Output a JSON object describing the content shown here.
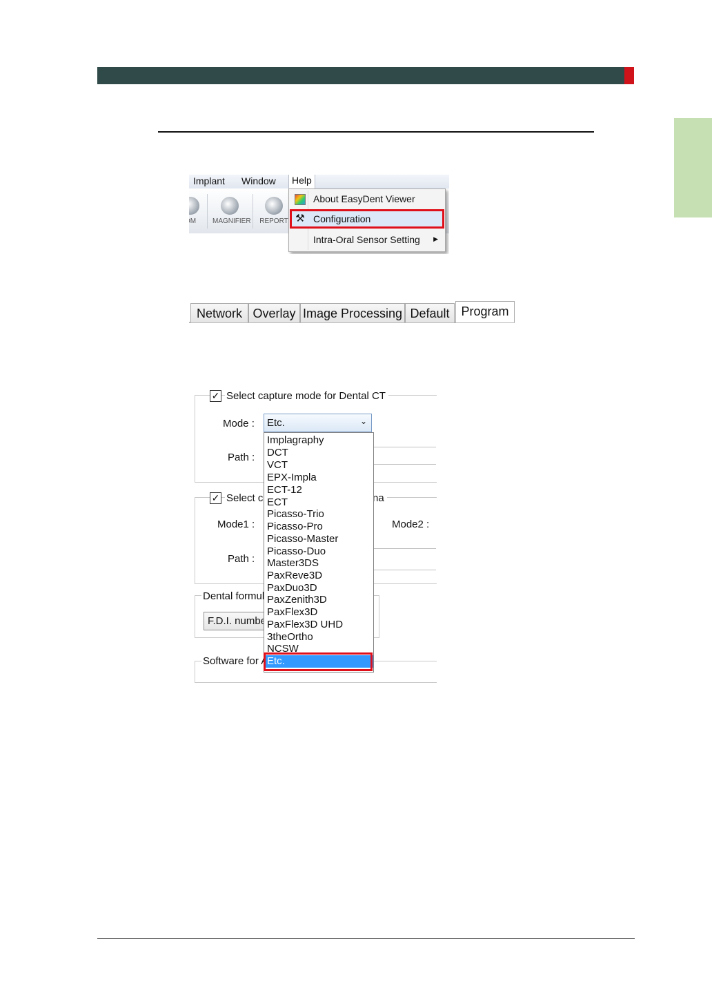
{
  "menu_bar": {
    "implant": "Implant",
    "window": "Window",
    "help": "Help"
  },
  "toolbar": {
    "zoom": "OM",
    "magnifier": "MAGNIFIER",
    "report": "REPORT"
  },
  "help_menu": [
    {
      "label": "About EasyDent Viewer",
      "icon": "color-palette-icon"
    },
    {
      "label": "Configuration",
      "icon": "tools-icon"
    },
    {
      "label": "Intra-Oral Sensor Setting",
      "icon": "",
      "submenu": true
    }
  ],
  "config_tabs": [
    {
      "label": "Network"
    },
    {
      "label": "Overlay"
    },
    {
      "label": "Image Processing"
    },
    {
      "label": "Default"
    },
    {
      "label": "Program",
      "active": true
    }
  ],
  "program_panel": {
    "ct_group_title": "Select capture mode for Dental CT",
    "ct_checked": "✓",
    "mode_label": "Mode :",
    "mode_value": "Etc.",
    "path_label": "Path :",
    "pano_group_title_start": "Select c",
    "pano_group_title_end": "na",
    "pano_checked": "✓",
    "mode1_label": "Mode1 :",
    "mode2_label": "Mode2 :",
    "path2_label": "Path :",
    "dental_formula_title": "Dental formula",
    "dental_formula_value": "F.D.I. numbe",
    "software_title": "Software for A",
    "mode_options": [
      "Implagraphy",
      "DCT",
      "VCT",
      "EPX-Impla",
      "ECT-12",
      "ECT",
      "Picasso-Trio",
      "Picasso-Pro",
      "Picasso-Master",
      "Picasso-Duo",
      "Master3DS",
      "PaxReve3D",
      "PaxDuo3D",
      "PaxZenith3D",
      "PaxFlex3D",
      "PaxFlex3D UHD",
      "3theOrtho",
      "NCSW"
    ],
    "selected_option": "Etc."
  },
  "colors": {
    "header": "#2f4a48",
    "accent": "#d0121b",
    "side_tab": "#c6e0b4",
    "highlight": "#e0101a",
    "selection": "#3399ff"
  }
}
